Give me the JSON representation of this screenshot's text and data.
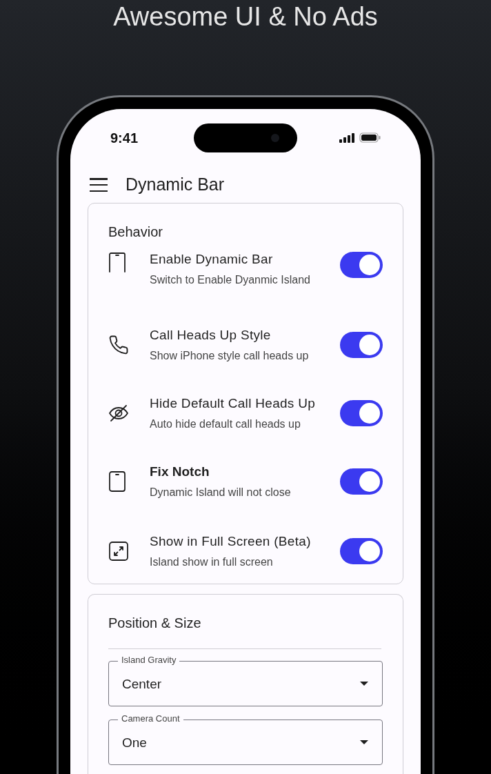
{
  "headline": "Awesome UI & No Ads",
  "status_bar": {
    "time": "9:41"
  },
  "app_bar": {
    "title": "Dynamic Bar"
  },
  "behavior": {
    "title": "Behavior",
    "items": [
      {
        "kind": "phone-top",
        "title": "Enable Dynamic Bar",
        "subtitle": "Switch to Enable Dyanmic Island",
        "bold": false,
        "on": true
      },
      {
        "kind": "call",
        "title": "Call Heads Up Style",
        "subtitle": "Show iPhone style call heads up",
        "bold": false,
        "on": true
      },
      {
        "kind": "eye-off",
        "title": "Hide Default Call Heads Up",
        "subtitle": "Auto hide default call heads up",
        "bold": false,
        "on": true
      },
      {
        "kind": "phone",
        "title": "Fix Notch",
        "subtitle": "Dynamic Island will not close",
        "bold": true,
        "on": true
      },
      {
        "kind": "expand",
        "title": "Show in Full Screen (Beta)",
        "subtitle": "Island show in full screen",
        "bold": false,
        "on": true
      }
    ]
  },
  "position": {
    "title": "Position & Size",
    "fields": [
      {
        "label": "Island Gravity",
        "value": "Center"
      },
      {
        "label": "Camera Count",
        "value": "One"
      }
    ]
  }
}
